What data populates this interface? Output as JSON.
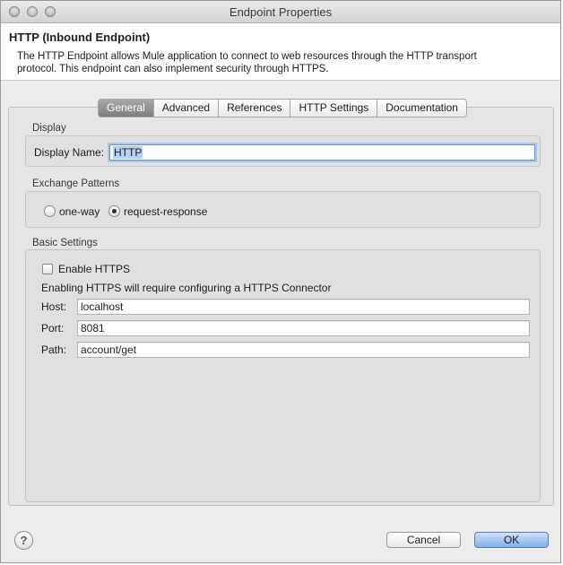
{
  "window": {
    "title": "Endpoint Properties"
  },
  "header": {
    "title": "HTTP (Inbound Endpoint)",
    "description": "The HTTP Endpoint allows Mule application to connect to web resources through the HTTP transport protocol. This endpoint can also implement security through HTTPS."
  },
  "tabs": [
    {
      "label": "General",
      "active": true
    },
    {
      "label": "Advanced",
      "active": false
    },
    {
      "label": "References",
      "active": false
    },
    {
      "label": "HTTP Settings",
      "active": false
    },
    {
      "label": "Documentation",
      "active": false
    }
  ],
  "display": {
    "section_label": "Display",
    "name_label": "Display Name:",
    "name_value": "HTTP"
  },
  "exchange": {
    "section_label": "Exchange Patterns",
    "options": [
      {
        "label": "one-way",
        "checked": false
      },
      {
        "label": "request-response",
        "checked": true
      }
    ]
  },
  "basic": {
    "section_label": "Basic Settings",
    "enable_https_label": "Enable HTTPS",
    "enable_https_checked": false,
    "https_note": "Enabling HTTPS will require configuring a HTTPS Connector",
    "host_label": "Host:",
    "host_value": "localhost",
    "port_label": "Port:",
    "port_value": "8081",
    "path_label": "Path:",
    "path_value": "account/get"
  },
  "footer": {
    "help_glyph": "?",
    "cancel_label": "Cancel",
    "ok_label": "OK"
  }
}
